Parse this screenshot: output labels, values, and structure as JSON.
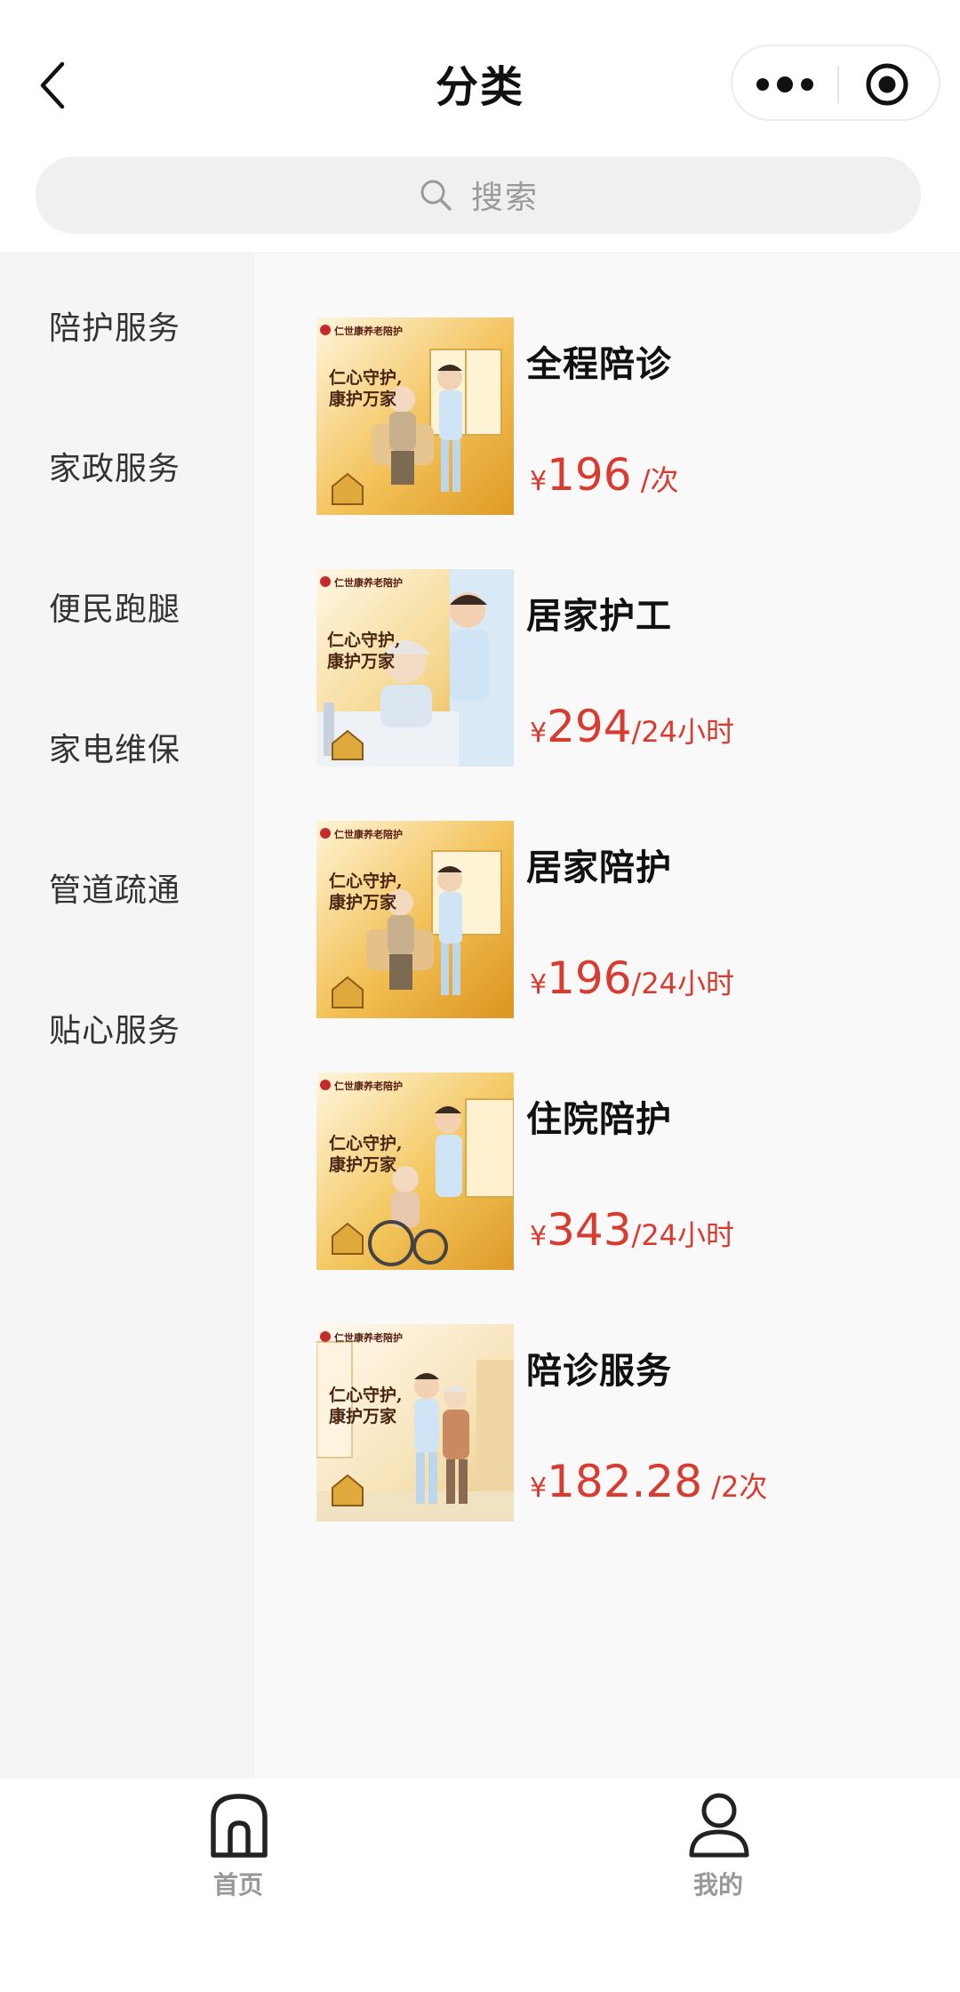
{
  "header": {
    "title": "分类"
  },
  "search": {
    "placeholder": "搜索"
  },
  "sidebar": {
    "items": [
      {
        "label": "陪护服务"
      },
      {
        "label": "家政服务"
      },
      {
        "label": "便民跑腿"
      },
      {
        "label": "家电维保"
      },
      {
        "label": "管道疏通"
      },
      {
        "label": "贴心服务"
      }
    ]
  },
  "products": [
    {
      "name": "全程陪诊",
      "currency": "¥",
      "price": "196",
      "unit": " /次"
    },
    {
      "name": "居家护工",
      "currency": "¥",
      "price": "294",
      "unit": "/24小时"
    },
    {
      "name": "居家陪护",
      "currency": "¥",
      "price": "196",
      "unit": "/24小时"
    },
    {
      "name": "住院陪护",
      "currency": "¥",
      "price": "343",
      "unit": "/24小时"
    },
    {
      "name": "陪诊服务",
      "currency": "¥",
      "price": "182.28",
      "unit": " /2次"
    }
  ],
  "thumbnail": {
    "brand": "仁世康养老陪护",
    "slogan_line1": "仁心守护,",
    "slogan_line2": "康护万家"
  },
  "tabbar": {
    "items": [
      {
        "label": "首页",
        "icon": "home-icon"
      },
      {
        "label": "我的",
        "icon": "user-icon"
      }
    ]
  },
  "colors": {
    "accent_price": "#d83b2f",
    "sidebar_bg": "#f5f5f5",
    "content_bg": "#f9f9f9"
  }
}
